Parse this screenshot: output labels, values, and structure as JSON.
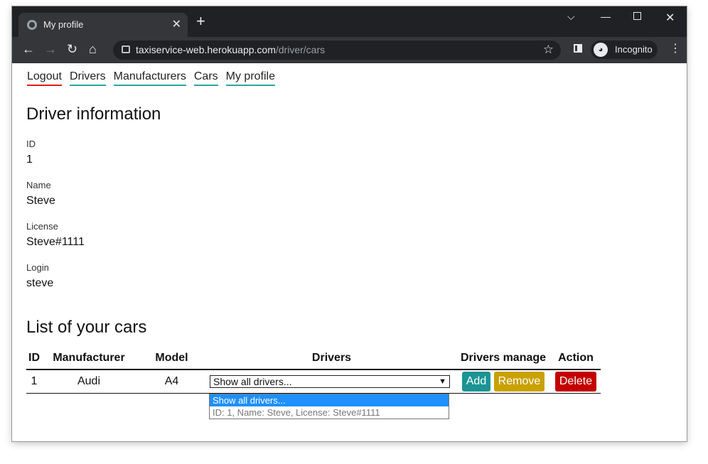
{
  "browser": {
    "tab_title": "My profile",
    "url_host": "taxiservice-web.herokuapp.com",
    "url_path": "/driver/cars",
    "incognito_label": "Incognito",
    "icons": [
      "globe-icon",
      "close-icon",
      "plus-icon",
      "back-icon",
      "forward-icon",
      "reload-icon",
      "home-icon",
      "lock-icon",
      "star-icon",
      "side-panel-icon",
      "incognito-icon",
      "menu-icon",
      "minimize-icon",
      "maximize-icon",
      "window-close-icon",
      "tab-search-icon"
    ]
  },
  "nav": {
    "logout": "Logout",
    "drivers": "Drivers",
    "manufacturers": "Manufacturers",
    "cars": "Cars",
    "my_profile": "My profile"
  },
  "driver": {
    "heading": "Driver information",
    "id_label": "ID",
    "id_value": "1",
    "name_label": "Name",
    "name_value": "Steve",
    "license_label": "License",
    "license_value": "Steve#1111",
    "login_label": "Login",
    "login_value": "steve"
  },
  "cars": {
    "heading": "List of your cars",
    "columns": {
      "id": "ID",
      "manufacturer": "Manufacturer",
      "model": "Model",
      "drivers": "Drivers",
      "drivers_manage": "Drivers manage",
      "action": "Action"
    },
    "rows": [
      {
        "id": "1",
        "manufacturer": "Audi",
        "model": "A4",
        "drivers_select": "Show all drivers...",
        "add": "Add",
        "remove": "Remove",
        "delete": "Delete"
      }
    ],
    "dropdown_options": [
      "Show all drivers...",
      "ID: 1, Name: Steve, License: Steve#1111"
    ]
  },
  "colors": {
    "add": "#1b9494",
    "remove": "#c9a100",
    "delete": "#c40000",
    "nav_underline": "#2aa6a6",
    "logout_underline": "#e01b1b"
  }
}
